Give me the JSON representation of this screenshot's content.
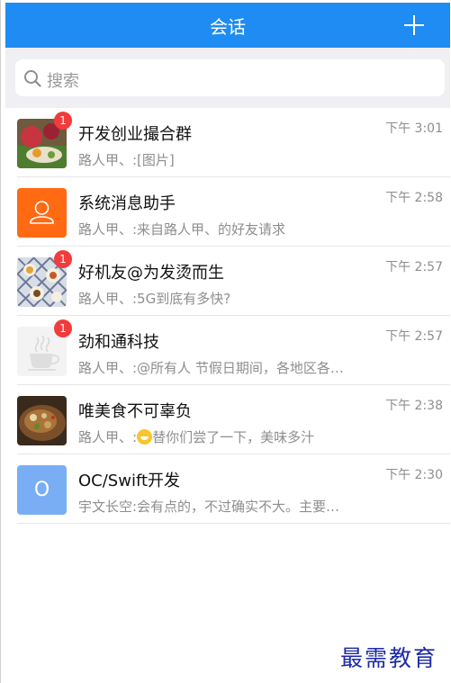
{
  "navbar": {
    "title": "会话",
    "add_icon": "plus-icon"
  },
  "search": {
    "placeholder": "搜索",
    "icon": "search-icon"
  },
  "conversations": [
    {
      "title": "开发创业撮合群",
      "subtitle": "路人甲、:[图片]",
      "time": "下午 3:01",
      "badge": "1",
      "avatar": "food-photo-avatar"
    },
    {
      "title": "系统消息助手",
      "subtitle": "路人甲、:来自路人甲、的好友请求",
      "time": "下午 2:58",
      "badge": "",
      "avatar": "person-icon",
      "avatar_color": "#ff6a13"
    },
    {
      "title": "好机友@为发烫而生",
      "subtitle": "路人甲、:5G到底有多快?",
      "time": "下午 2:57",
      "badge": "1",
      "avatar": "table-photo-avatar"
    },
    {
      "title": "劲和通科技",
      "subtitle": "路人甲、:@所有人 节假日期间，各地区各…",
      "time": "下午 2:57",
      "badge": "1",
      "avatar": "coffee-cup-icon"
    },
    {
      "title": "唯美食不可辜负",
      "subtitle_prefix": "路人甲、:",
      "subtitle_suffix": "替你们尝了一下，美味多汁",
      "emoji": "grinning-face-emoji",
      "time": "下午 2:38",
      "badge": "",
      "avatar": "dish-photo-avatar"
    },
    {
      "title": "OC/Swift开发",
      "subtitle": "宇文长空:会有点的，不过确实不大。主要…",
      "time": "下午 2:30",
      "badge": "",
      "avatar": "letter-avatar",
      "avatar_letter": "O",
      "avatar_color": "#79aef4"
    }
  ],
  "watermark": "最需教育",
  "colors": {
    "navbar": "#1e8cf2",
    "badge": "#f23b3b",
    "background": "#efeff4"
  }
}
